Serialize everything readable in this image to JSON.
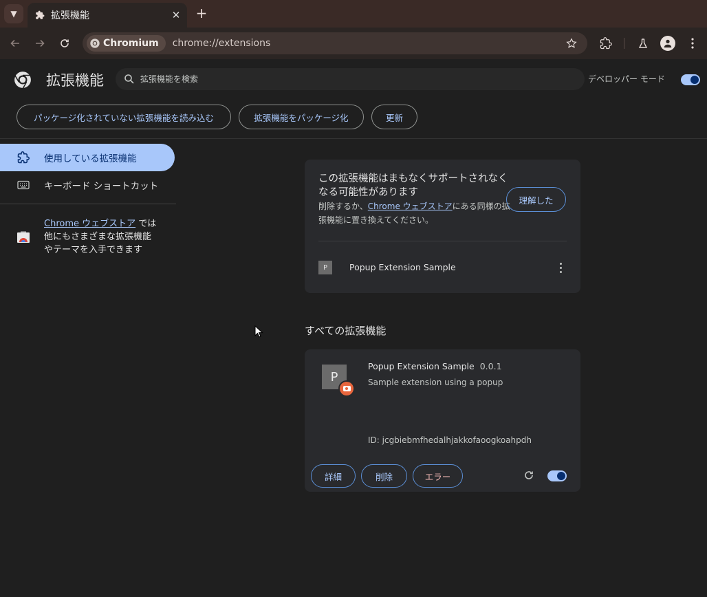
{
  "browser": {
    "tab": {
      "title": "拡張機能"
    },
    "omnibox": {
      "site_chip": "Chromium",
      "url": "chrome://extensions"
    }
  },
  "header": {
    "title": "拡張機能",
    "search_placeholder": "拡張機能を検索",
    "developer_mode_label": "デベロッパー モード",
    "developer_mode_on": true
  },
  "actions": {
    "load_unpacked": "パッケージ化されていない拡張機能を読み込む",
    "pack_extension": "拡張機能をパッケージ化",
    "update": "更新"
  },
  "sidebar": {
    "items": [
      {
        "label": "使用している拡張機能",
        "icon": "extension-icon",
        "active": true
      },
      {
        "label": "キーボード ショートカット",
        "icon": "keyboard-icon",
        "active": false
      }
    ],
    "store": {
      "link": "Chrome ウェブストア",
      "line1_suffix": " では",
      "line2": "他にもさまざまな拡張機能",
      "line3": "やテーマを入手できます"
    }
  },
  "warning_card": {
    "title": "この拡張機能はまもなくサポートされなくなる可能性があります",
    "desc_prefix": "削除するか、",
    "desc_link": "Chrome ウェブストア",
    "desc_suffix": "にある同様の拡張機能に置き換えてください。",
    "ack_button": "理解した",
    "extension": {
      "icon_letter": "P",
      "name": "Popup Extension Sample"
    }
  },
  "all_extensions": {
    "section_title": "すべての拡張機能",
    "cards": [
      {
        "icon_letter": "P",
        "name": "Popup Extension Sample",
        "version": "0.0.1",
        "description": "Sample extension using a popup",
        "id_text": "ID: jcgbiebmfhedalhjakkofaoogkoahpdh",
        "details_button": "詳細",
        "remove_button": "削除",
        "errors_button": "エラー",
        "enabled": true
      }
    ]
  },
  "colors": {
    "accent": "#a8c7fa",
    "error": "#f2b8b5",
    "badge": "#e8663d"
  }
}
